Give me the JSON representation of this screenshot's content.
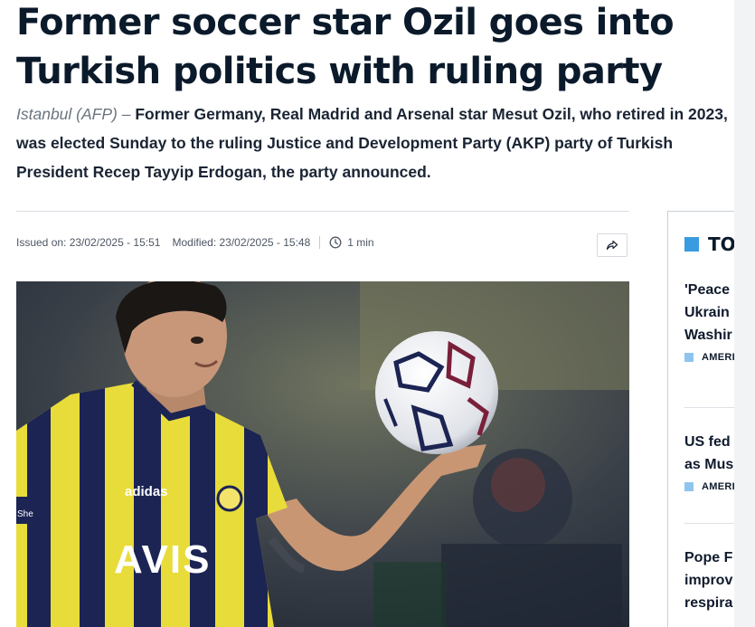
{
  "article": {
    "headline": "Former soccer star Ozil goes into Turkish politics with ruling party",
    "dateline": "Istanbul (AFP) –",
    "lead": "Former Germany, Real Madrid and Arsenal star Mesut Ozil, who retired in 2023, was elected Sunday to the ruling Justice and Development Party (AKP) party of Turkish President Recep Tayyip Erdogan, the party announced.",
    "issued": "Issued on: 23/02/2025 - 15:51",
    "modified": "Modified: 23/02/2025 - 15:48",
    "read_time": "1 min",
    "share_icon": "share-arrow-icon",
    "photo_text": {
      "shirt_sponsor": "AVIS",
      "shirt_brand": "adidas",
      "sleeve_patch": "She"
    }
  },
  "sidebar": {
    "title": "TO",
    "stories": [
      {
        "lines": [
          "'Peace",
          "Ukrain",
          "Washir"
        ],
        "tag": "AMERI"
      },
      {
        "lines": [
          "US fed",
          "as Mus"
        ],
        "tag": "AMERI"
      },
      {
        "lines": [
          "Pope F",
          "improv",
          "respira"
        ],
        "tag": ""
      }
    ]
  },
  "colors": {
    "accent_blue": "#3a9be0",
    "tag_blue": "#8ec5ee",
    "headline_text": "#0b1a2b",
    "jersey_yellow": "#e8dc3a",
    "jersey_navy": "#1b2453"
  }
}
